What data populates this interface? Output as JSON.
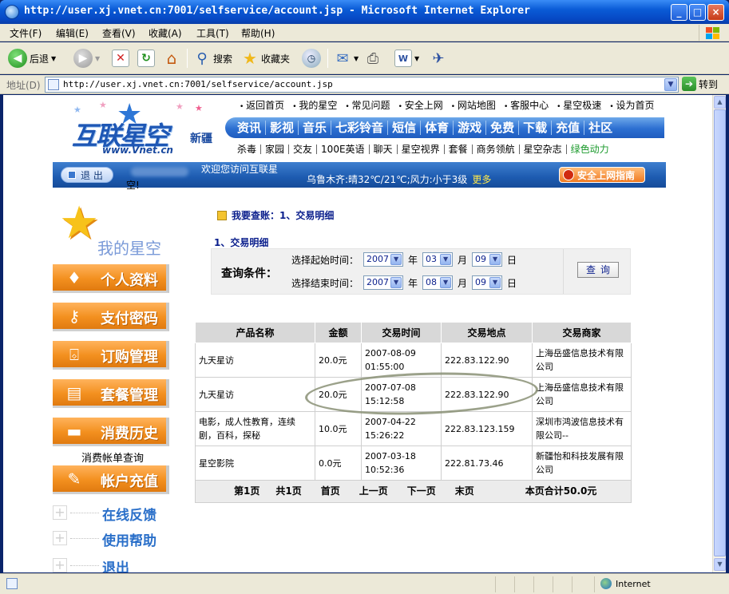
{
  "window": {
    "title": "http://user.xj.vnet.cn:7001/selfservice/account.jsp - Microsoft Internet Explorer",
    "minimize": "_",
    "maximize": "□",
    "close": "×"
  },
  "menu": [
    "文件(F)",
    "编辑(E)",
    "查看(V)",
    "收藏(A)",
    "工具(T)",
    "帮助(H)"
  ],
  "toolbar": {
    "back": "后退",
    "search": "搜索",
    "favorites": "收藏夹",
    "icons": [
      "back-icon",
      "forward-icon",
      "stop-icon",
      "refresh-icon",
      "home-icon",
      "search-icon",
      "favorites-icon",
      "history-icon",
      "mail-icon",
      "print-icon",
      "edit-icon",
      "messenger-icon"
    ]
  },
  "address": {
    "label": "地址(D)",
    "url": "http://user.xj.vnet.cn:7001/selfservice/account.jsp",
    "go": "转到"
  },
  "status": {
    "zone": "Internet"
  },
  "site": {
    "logo": "互联星空",
    "logo_url": "www.Vnet.cn",
    "region": "新疆",
    "toplinks": [
      "返回首页",
      "我的星空",
      "常见问题",
      "安全上网",
      "网站地图",
      "客服中心",
      "星空极速",
      "设为首页"
    ],
    "nav": [
      "资讯",
      "影视",
      "音乐",
      "七彩铃音",
      "短信",
      "体育",
      "游戏",
      "免费",
      "下载",
      "充值",
      "社区"
    ],
    "subnav": [
      "杀毒",
      "家园",
      "交友",
      "100E英语",
      "聊天",
      "星空视界",
      "套餐",
      "商务领航",
      "星空杂志",
      "绿色动力"
    ],
    "logout": "退 出",
    "welcome": "欢迎您访问互联星",
    "welcome_cont": "空!",
    "weather": "乌鲁木齐:晴32℃/21℃;风力:小于3级",
    "weather_more": "更多",
    "safe_guide": "安全上网指南"
  },
  "sidebar": {
    "my_star": "我的星空",
    "buttons": [
      "个人资料",
      "支付密码",
      "订购管理",
      "套餐管理",
      "消费历史"
    ],
    "history_link": "消费帐单查询",
    "recharge": "帐户充值",
    "tree": [
      "在线反馈",
      "使用帮助",
      "退出"
    ]
  },
  "content": {
    "crumb": "我要查账：1、交易明细",
    "section_title": "1、交易明细",
    "query_label": "查询条件：",
    "start_label": "选择起始时间：",
    "end_label": "选择结束时间：",
    "start": {
      "year": "2007",
      "month": "03",
      "day": "09"
    },
    "end": {
      "year": "2007",
      "month": "08",
      "day": "09"
    },
    "unit_year": "年",
    "unit_month": "月",
    "unit_day": "日",
    "query_button": "查询"
  },
  "table": {
    "headers": [
      "产品名称",
      "金额",
      "交易时间",
      "交易地点",
      "交易商家"
    ],
    "rows": [
      {
        "product": "九天星访",
        "amount": "20.0元",
        "time": "2007-08-09 01:55:00",
        "ip": "222.83.122.90",
        "merchant": "上海岳盛信息技术有限公司"
      },
      {
        "product": "九天星访",
        "amount": "20.0元",
        "time": "2007-07-08 15:12:58",
        "ip": "222.83.122.90",
        "merchant": "上海岳盛信息技术有限公司"
      },
      {
        "product": "电影，成人性教育，连续剧，百科，探秘",
        "amount": "10.0元",
        "time": "2007-04-22 15:26:22",
        "ip": "222.83.123.159",
        "merchant": "深圳市鸿波信息技术有限公司--"
      },
      {
        "product": "星空影院",
        "amount": "0.0元",
        "time": "2007-03-18 10:52:36",
        "ip": "222.81.73.46",
        "merchant": "新疆怡和科技发展有限公司"
      }
    ],
    "footer": {
      "page": "第1页",
      "total_pages": "共1页",
      "first": "首页",
      "prev": "上一页",
      "next": "下一页",
      "last": "末页",
      "total": "本页合计50.0元"
    }
  }
}
